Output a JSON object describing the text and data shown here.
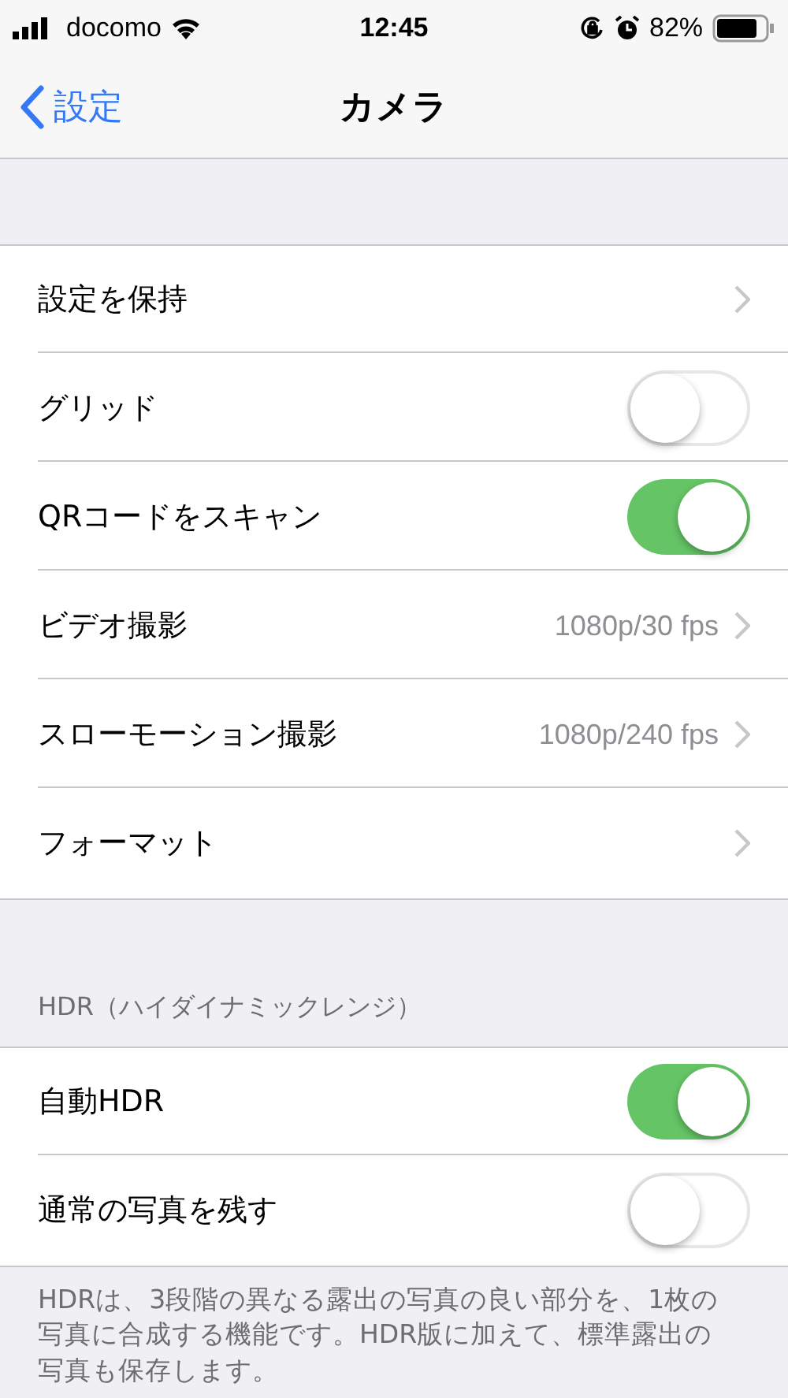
{
  "status_bar": {
    "carrier": "docomo",
    "time": "12:45",
    "battery": "82%"
  },
  "nav": {
    "back": "設定",
    "title": "カメラ"
  },
  "sections": [
    {
      "rows": [
        {
          "kind": "link",
          "label": "設定を保持"
        },
        {
          "kind": "toggle",
          "label": "グリッド",
          "on": false
        },
        {
          "kind": "toggle",
          "label": "QRコードをスキャン",
          "on": true
        },
        {
          "kind": "link",
          "label": "ビデオ撮影",
          "value": "1080p/30 fps"
        },
        {
          "kind": "link",
          "label": "スローモーション撮影",
          "value": "1080p/240 fps"
        },
        {
          "kind": "link",
          "label": "フォーマット"
        }
      ]
    },
    {
      "header": "HDR（ハイダイナミックレンジ）",
      "rows": [
        {
          "kind": "toggle",
          "label": "自動HDR",
          "on": true
        },
        {
          "kind": "toggle",
          "label": "通常の写真を残す",
          "on": false
        }
      ],
      "footer": "HDRは、3段階の異なる露出の写真の良い部分を、1枚の写真に合成する機能です。HDR版に加えて、標準露出の写真も保存します。"
    }
  ]
}
